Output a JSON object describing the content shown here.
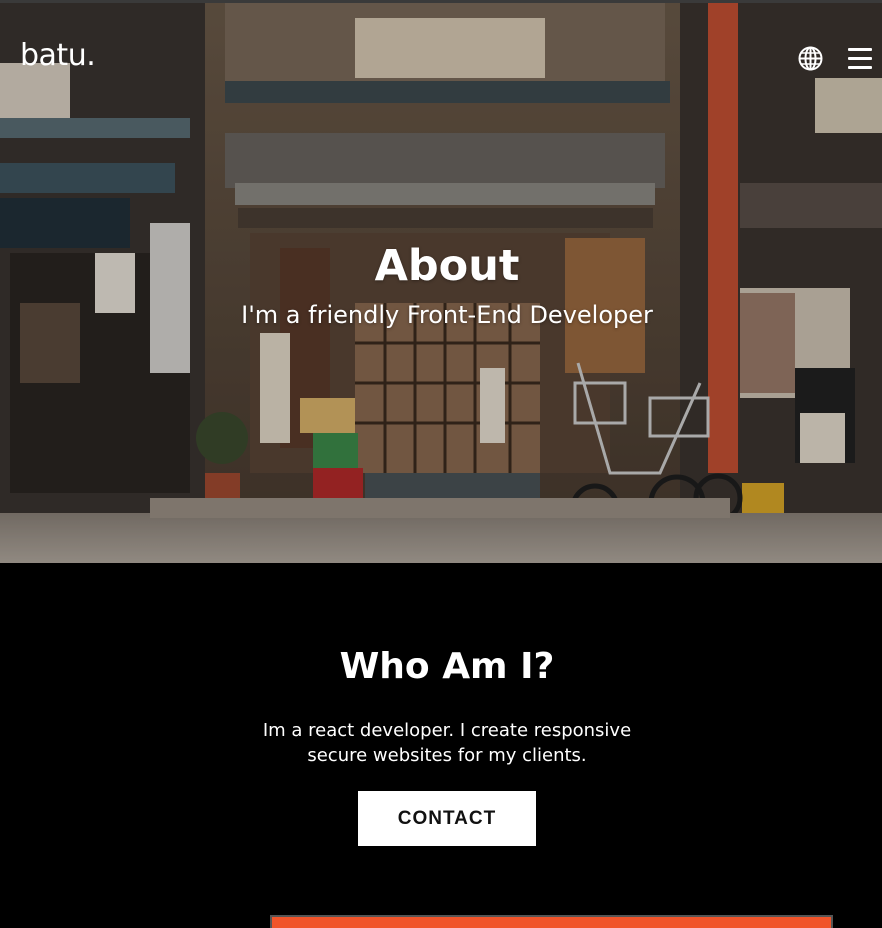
{
  "header": {
    "brand": "batu.",
    "globe_icon": "globe-icon",
    "menu_icon": "hamburger-menu-icon"
  },
  "hero": {
    "title": "About",
    "subtitle": "I'm a friendly Front-End Developer"
  },
  "about": {
    "title": "Who Am I?",
    "text": "Im a react developer. I create responsive secure websites for my clients.",
    "contact_label": "CONTACT"
  },
  "colors": {
    "background": "#000000",
    "text": "#ffffff",
    "button_bg": "#ffffff",
    "button_text": "#111111",
    "accent_orange": "#f0542a"
  }
}
